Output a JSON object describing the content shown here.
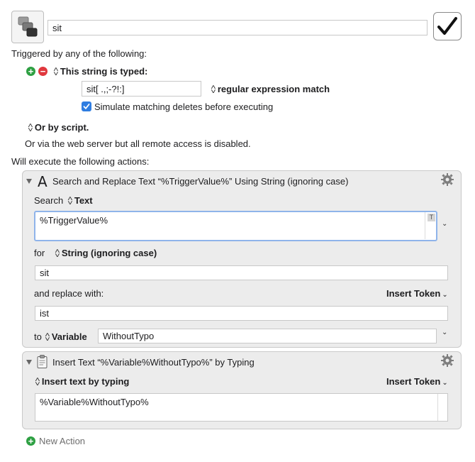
{
  "macro": {
    "name": "sit",
    "enabled_checkmark": "✓"
  },
  "triggers": {
    "heading": "Triggered by any of the following:",
    "typed_label": "This string is typed:",
    "typed_value": "sit[ .,;-?!:]",
    "match_mode": "regular expression match",
    "simulate_label": "Simulate matching deletes before executing",
    "simulate_checked": true,
    "script_label": "Or by script.",
    "web_note": "Or via the web server but all remote access is disabled."
  },
  "actions": {
    "heading": "Will execute the following actions:",
    "search_replace": {
      "title": "Search and Replace Text “%TriggerValue%” Using String (ignoring case)",
      "search_label": "Search",
      "search_source": "Text",
      "search_text": "%TriggerValue%",
      "text_badge": "T",
      "for_label": "for",
      "for_mode": "String (ignoring case)",
      "for_value": "sit",
      "replace_label": "and replace with:",
      "insert_token": "Insert Token",
      "replace_value": "ist",
      "to_label": "to",
      "to_target": "Variable",
      "variable_name": "WithoutTypo"
    },
    "insert_text": {
      "title": "Insert Text “%Variable%WithoutTypo%” by Typing",
      "mode": "Insert text by typing",
      "insert_token": "Insert Token",
      "text": "%Variable%WithoutTypo%"
    },
    "new_action": "New Action"
  },
  "colors": {
    "accent": "#2f7de1",
    "add_green": "#2ea043",
    "remove_red": "#e0383e",
    "panel_bg": "#ececec"
  }
}
